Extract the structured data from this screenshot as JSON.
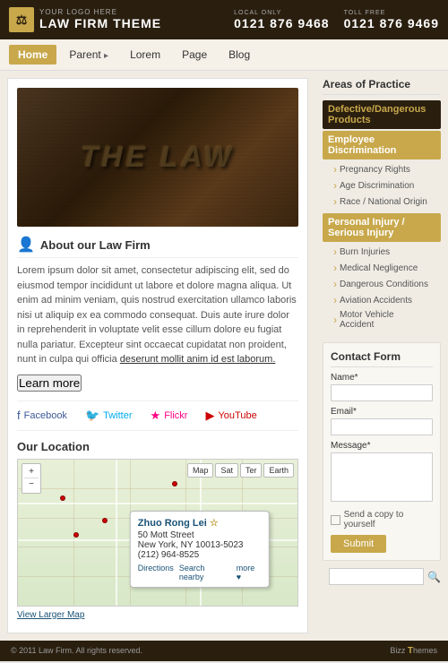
{
  "header": {
    "logo_top": "YOUR LOGO HERE",
    "logo_bottom": "LAW FIRM THEME",
    "logo_icon": "⚖",
    "phone_local_label": "LOCAL ONLY",
    "phone_local": "0121 876 9468",
    "phone_toll_label": "TOLL FREE",
    "phone_toll": "0121 876 9469"
  },
  "nav": {
    "items": [
      {
        "label": "Home",
        "active": true
      },
      {
        "label": "Parent",
        "has_arrow": true
      },
      {
        "label": "Lorem"
      },
      {
        "label": "Page"
      },
      {
        "label": "Blog"
      }
    ]
  },
  "hero": {
    "text": "THE LAW"
  },
  "about": {
    "title": "About our Law Firm",
    "body": "Lorem ipsum dolor sit amet, consectetur adipiscing elit, sed do eiusmod tempor incididunt ut labore et dolore magna aliqua. Ut enim ad minim veniam, quis nostrud exercitation ullamco laboris nisi ut aliquip ex ea commodo consequat. Duis aute irure dolor in reprehenderit in voluptate velit esse cillum dolore eu fugiat nulla pariatur. Excepteur sint occaecat cupidatat non proident, sunt in culpa qui officia deserunt mollit anim id est laborum.",
    "underline_text": "deserunt mollit anim id est laborum.",
    "learn_more": "Learn more"
  },
  "social": {
    "items": [
      {
        "name": "Facebook",
        "icon": "f",
        "class": "social-facebook"
      },
      {
        "name": "Twitter",
        "icon": "t",
        "class": "social-twitter"
      },
      {
        "name": "Flickr",
        "icon": "★",
        "class": "social-flickr"
      },
      {
        "name": "YouTube",
        "icon": "▶",
        "class": "social-youtube"
      }
    ]
  },
  "location": {
    "title": "Our Location",
    "popup": {
      "name": "Zhuo Rong Lei",
      "address_line1": "50 Mott Street",
      "address_line2": "New York, NY 10013-5023",
      "phone": "(212) 964-8525"
    },
    "view_larger": "View Larger Map",
    "map_tabs": [
      "Map",
      "Sat",
      "Ter",
      "Earth"
    ]
  },
  "sidebar": {
    "areas_title": "Areas of Practice",
    "areas": [
      {
        "label": "Defective/Dangerous Products",
        "type": "category-dark"
      },
      {
        "label": "Employee Discrimination",
        "type": "category-gold"
      },
      {
        "label": "Pregnancy Rights",
        "type": "sub"
      },
      {
        "label": "Age Discrimination",
        "type": "sub"
      },
      {
        "label": "Race / National Origin",
        "type": "sub"
      },
      {
        "label": "Personal Injury / Serious Injury",
        "type": "category-gold"
      },
      {
        "label": "Burn Injuries",
        "type": "sub"
      },
      {
        "label": "Medical Negligence",
        "type": "sub"
      },
      {
        "label": "Dangerous Conditions",
        "type": "sub"
      },
      {
        "label": "Aviation Accidents",
        "type": "sub"
      },
      {
        "label": "Motor Vehicle Accident",
        "type": "sub"
      }
    ],
    "contact": {
      "title": "Contact Form",
      "name_label": "Name*",
      "email_label": "Email*",
      "message_label": "Message*",
      "checkbox_label": "Send a copy to yourself",
      "submit_label": "Submit"
    }
  },
  "footer": {
    "copyright": "© 2011 Law Firm. All rights reserved.",
    "brand": "Bizz Themes"
  }
}
